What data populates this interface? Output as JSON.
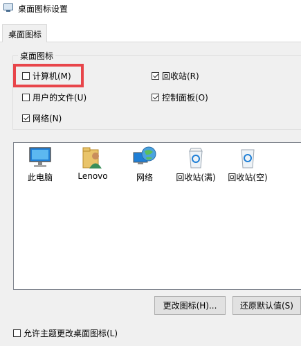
{
  "window": {
    "title": "桌面图标设置"
  },
  "tabs": [
    {
      "label": "桌面图标"
    }
  ],
  "group": {
    "title": "桌面图标",
    "checkboxes": [
      {
        "label": "计算机(M)",
        "checked": false
      },
      {
        "label": "回收站(R)",
        "checked": true
      },
      {
        "label": "用户的文件(U)",
        "checked": false
      },
      {
        "label": "控制面板(O)",
        "checked": true
      },
      {
        "label": "网络(N)",
        "checked": true
      }
    ]
  },
  "icons": [
    {
      "label": "此电脑",
      "icon": "monitor-icon"
    },
    {
      "label": "Lenovo",
      "icon": "user-folder-icon"
    },
    {
      "label": "网络",
      "icon": "network-globe-icon"
    },
    {
      "label": "回收站(满)",
      "icon": "recycle-bin-full-icon"
    },
    {
      "label": "回收站(空)",
      "icon": "recycle-bin-empty-icon"
    }
  ],
  "buttons": {
    "change_icon": "更改图标(H)...",
    "restore_default": "还原默认值(S)"
  },
  "allow_themes": {
    "label": "允许主题更改桌面图标(L)",
    "checked": false
  },
  "colors": {
    "highlight": "#e8454a",
    "panel": "#f0f0f0"
  }
}
